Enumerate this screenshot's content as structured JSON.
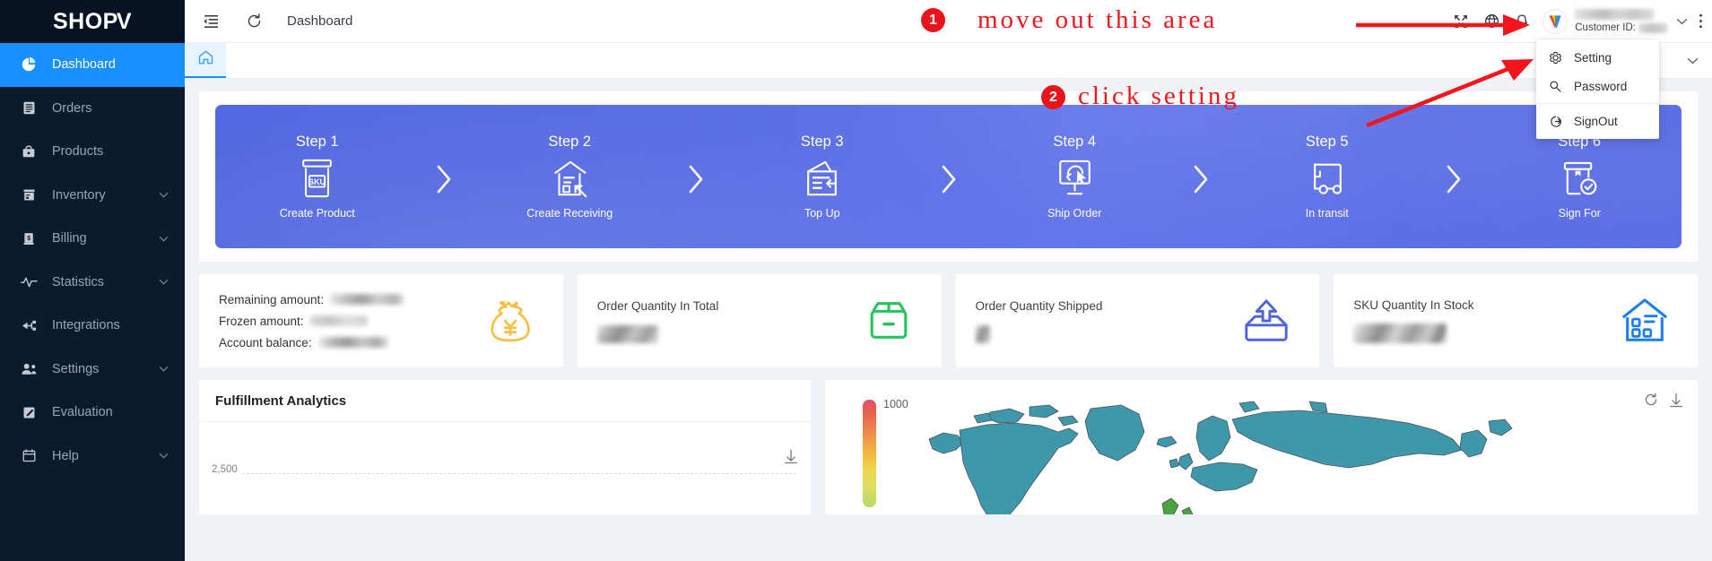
{
  "brand": {
    "logo": "SHOP",
    "logo_accent": "V"
  },
  "sidebar": {
    "items": [
      {
        "label": "Dashboard",
        "icon": "pie-chart-icon",
        "active": true,
        "caret": false
      },
      {
        "label": "Orders",
        "icon": "list-icon",
        "active": false,
        "caret": false
      },
      {
        "label": "Products",
        "icon": "bag-icon",
        "active": false,
        "caret": false
      },
      {
        "label": "Inventory",
        "icon": "box-icon",
        "active": false,
        "caret": true
      },
      {
        "label": "Billing",
        "icon": "money-icon",
        "active": false,
        "caret": true
      },
      {
        "label": "Statistics",
        "icon": "pulse-icon",
        "active": false,
        "caret": true
      },
      {
        "label": "Integrations",
        "icon": "plug-icon",
        "active": false,
        "caret": false
      },
      {
        "label": "Settings",
        "icon": "users-icon",
        "active": false,
        "caret": true
      },
      {
        "label": "Evaluation",
        "icon": "edit-square-icon",
        "active": false,
        "caret": false
      },
      {
        "label": "Help",
        "icon": "calendar-icon",
        "active": false,
        "caret": true
      }
    ]
  },
  "topbar": {
    "collapse_icon": "menu-fold-icon",
    "refresh_icon": "refresh-icon",
    "title": "Dashboard",
    "fullscreen_icon": "fullscreen-icon",
    "language_icon": "globe-icon",
    "notification_icon": "bell-icon",
    "avatar_icon": "user-avatar-icon",
    "user_name": "",
    "customer_id_label": "Customer ID:",
    "customer_id_value": "",
    "caret_icon": "chevron-down-icon",
    "more_icon": "more-vertical-icon"
  },
  "tabstrip": {
    "home_icon": "home-icon",
    "caret_icon": "chevron-down-icon"
  },
  "user_menu": {
    "items": [
      {
        "label": "Setting",
        "icon": "gear-icon"
      },
      {
        "label": "Password",
        "icon": "key-icon"
      },
      {
        "label": "SignOut",
        "icon": "signout-icon"
      }
    ]
  },
  "steps": {
    "items": [
      {
        "title": "Step 1",
        "label": "Create Product",
        "icon": "sku-box-icon"
      },
      {
        "title": "Step 2",
        "label": "Create Receiving",
        "icon": "receiving-doc-icon"
      },
      {
        "title": "Step 3",
        "label": "Top Up",
        "icon": "topup-invoice-icon"
      },
      {
        "title": "Step 4",
        "label": "Ship Order",
        "icon": "monitor-click-icon"
      },
      {
        "title": "Step 5",
        "label": "In transit",
        "icon": "truck-icon"
      },
      {
        "title": "Step 6",
        "label": "Sign For",
        "icon": "box-check-icon"
      }
    ],
    "arrow_icon": "chevron-right-icon"
  },
  "stats": {
    "balance_card": {
      "rows": [
        {
          "label": "Remaining amount:",
          "value": "",
          "redacted": true
        },
        {
          "label": "Frozen amount:",
          "value": "",
          "redacted": true
        },
        {
          "label": "Account balance:",
          "value": "",
          "redacted": true
        }
      ],
      "icon": "money-bag-yen-icon",
      "icon_color": "#f5c043"
    },
    "cards": [
      {
        "title": "Order Quantity In Total",
        "value": "",
        "redacted": true,
        "icon": "open-box-icon",
        "icon_color": "#22c55e"
      },
      {
        "title": "Order Quantity Shipped",
        "value": "",
        "redacted": true,
        "icon": "upload-box-icon",
        "icon_color": "#4f63e0"
      },
      {
        "title": "SKU Quantity In Stock",
        "value": "",
        "redacted": true,
        "icon": "warehouse-icon",
        "icon_color": "#1a7ff0"
      }
    ]
  },
  "fulfillment": {
    "title": "Fulfillment Analytics",
    "download_icon": "download-icon"
  },
  "map_panel": {
    "refresh_icon": "refresh-icon",
    "download_icon": "download-icon",
    "colorbar_max": "1000"
  },
  "annotations": [
    {
      "number": "1",
      "text": "move out this area",
      "arrow": "right-arrow"
    },
    {
      "number": "2",
      "text": "click setting",
      "arrow": "up-right-arrow"
    }
  ],
  "chart_data": {
    "type": "line",
    "title": "Fulfillment Analytics",
    "xlabel": "",
    "ylabel": "",
    "categories": [],
    "values": [],
    "ytick_labels": [
      "2,500"
    ],
    "ylim": [
      0,
      2500
    ],
    "grid": true,
    "legend": "none"
  }
}
